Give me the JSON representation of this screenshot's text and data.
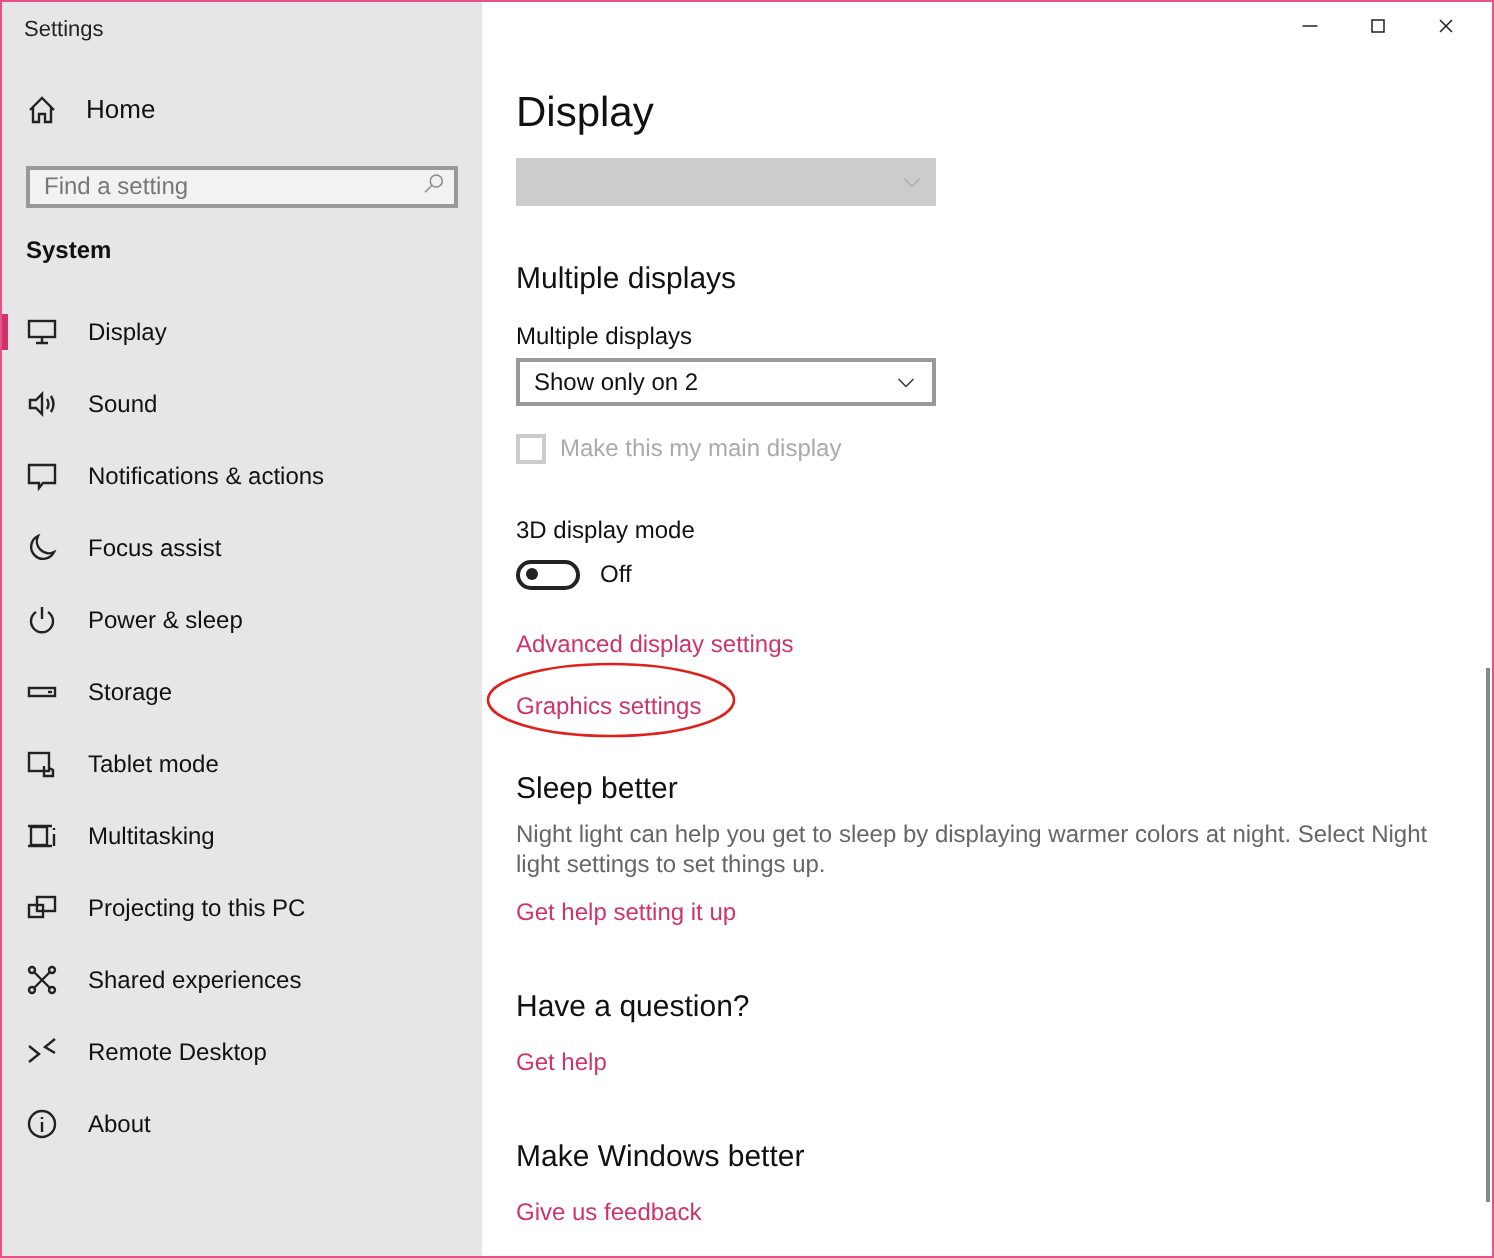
{
  "window": {
    "title": "Settings"
  },
  "sidebar": {
    "home": "Home",
    "search": {
      "placeholder": "Find a setting"
    },
    "section": "System",
    "items": [
      {
        "label": "Display",
        "selected": true
      },
      {
        "label": "Sound",
        "selected": false
      },
      {
        "label": "Notifications & actions",
        "selected": false
      },
      {
        "label": "Focus assist",
        "selected": false
      },
      {
        "label": "Power & sleep",
        "selected": false
      },
      {
        "label": "Storage",
        "selected": false
      },
      {
        "label": "Tablet mode",
        "selected": false
      },
      {
        "label": "Multitasking",
        "selected": false
      },
      {
        "label": "Projecting to this PC",
        "selected": false
      },
      {
        "label": "Shared experiences",
        "selected": false
      },
      {
        "label": "Remote Desktop",
        "selected": false
      },
      {
        "label": "About",
        "selected": false
      }
    ]
  },
  "page": {
    "title": "Display",
    "top_dropdown": {
      "disabled": true
    },
    "sections": [
      {
        "heading": "Multiple displays",
        "controls": [
          {
            "kind": "dropdown",
            "label": "Multiple displays",
            "value": "Show only on 2",
            "disabled": false
          },
          {
            "kind": "checkbox",
            "label": "Make this my main display",
            "checked": false,
            "disabled": true
          },
          {
            "kind": "toggle",
            "label": "3D display mode",
            "on": false,
            "state_label": "Off"
          },
          {
            "kind": "link",
            "label": "Advanced display settings",
            "highlighted": false
          },
          {
            "kind": "link",
            "label": "Graphics settings",
            "highlighted": true
          }
        ]
      },
      {
        "heading": "Sleep better",
        "controls": [
          {
            "kind": "text",
            "label": "Night light can help you get to sleep by displaying warmer colors at night. Select Night light settings to set things up."
          },
          {
            "kind": "link",
            "label": "Get help setting it up",
            "highlighted": false
          }
        ]
      },
      {
        "heading": "Have a question?",
        "controls": [
          {
            "kind": "link",
            "label": "Get help",
            "highlighted": false
          }
        ]
      },
      {
        "heading": "Make Windows better",
        "controls": [
          {
            "kind": "link",
            "label": "Give us feedback",
            "highlighted": false
          }
        ]
      }
    ]
  }
}
